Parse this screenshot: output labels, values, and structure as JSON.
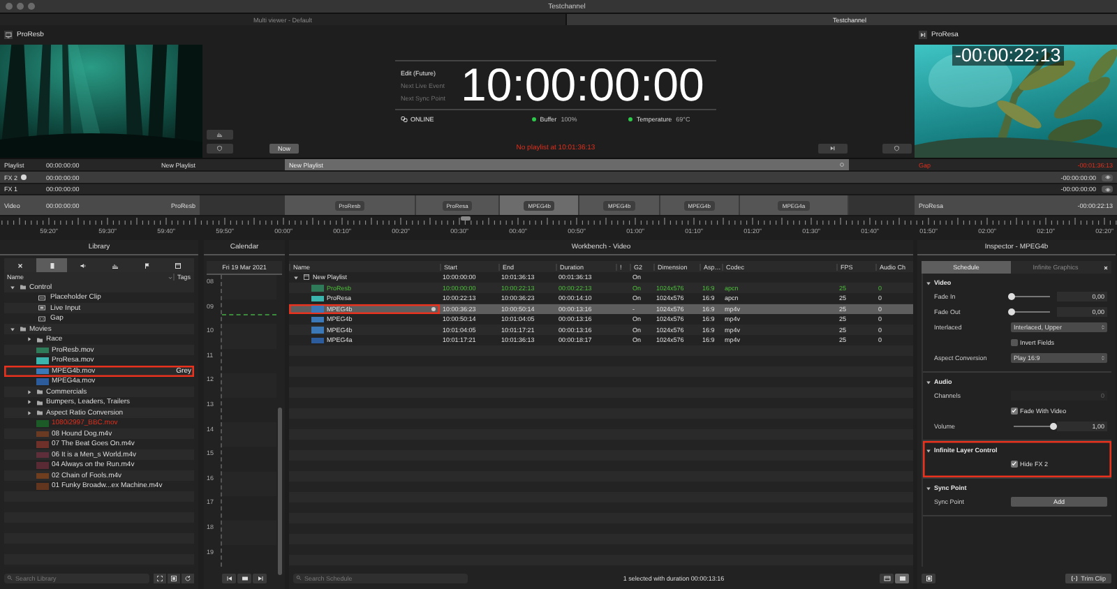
{
  "window": {
    "title": "Testchannel"
  },
  "tabs": [
    {
      "label": "Multi viewer - Default",
      "selected": false
    },
    {
      "label": "Testchannel",
      "selected": true
    }
  ],
  "program_preview": {
    "title": "ProResb",
    "kind": "picture"
  },
  "now_button": "Now",
  "clock": {
    "modes": [
      {
        "label": "Edit (Future)",
        "selected": true
      },
      {
        "label": "Next Live Event",
        "selected": false
      },
      {
        "label": "Next Sync Point",
        "selected": false
      }
    ],
    "time": "10:00:00:00",
    "connection": "ONLINE",
    "indicators": [
      {
        "label": "Buffer",
        "value": "100%",
        "color": "#2ec84a"
      },
      {
        "label": "Temperature",
        "value": "69°C",
        "color": "#2ec84a"
      }
    ],
    "message": "No playlist at 10:01:36:13"
  },
  "next_preview": {
    "title": "ProResa",
    "countdown": "-00:00:22:13",
    "kind": "picture"
  },
  "tracks": [
    {
      "name": "Playlist",
      "time": "00:00:00:00",
      "clip": "New Playlist",
      "marker": false
    },
    {
      "name": "FX 2",
      "time": "00:00:00:00",
      "marker": true
    },
    {
      "name": "FX 1",
      "time": "00:00:00:00",
      "marker": false
    },
    {
      "name": "Video",
      "time": "00:00:00:00",
      "clip": "ProResb",
      "marker": false
    }
  ],
  "timeline": {
    "playlist": "New Playlist",
    "blocks": [
      {
        "label": "ProResb",
        "selected": false
      },
      {
        "label": "ProResa",
        "selected": false
      },
      {
        "label": "MPEG4b",
        "selected": true
      },
      {
        "label": "MPEG4b",
        "selected": false
      },
      {
        "label": "MPEG4b",
        "selected": false
      },
      {
        "label": "MPEG4a",
        "selected": false
      }
    ]
  },
  "next_tracks": [
    {
      "kind": "playlist",
      "clip": "Gap",
      "time": "-00:01:36:13",
      "alert": true
    },
    {
      "kind": "layer",
      "time": "-00:00:00:00",
      "alert": false
    },
    {
      "kind": "layer",
      "time": "-00:00:00:00",
      "alert": false
    },
    {
      "kind": "video",
      "clip": "ProResa",
      "time": "-00:00:22:13",
      "alert": false
    }
  ],
  "ruler": {
    "labels": [
      "59:20\"",
      "59:30\"",
      "59:40\"",
      "59:50\"",
      "00:00\"",
      "00:10\"",
      "00:20\"",
      "00:30\"",
      "00:40\"",
      "00:50\"",
      "01:00\"",
      "01:10\"",
      "01:20\"",
      "01:30\"",
      "01:40\"",
      "01:50\"",
      "02:00\"",
      "02:10\"",
      "02:20\""
    ]
  },
  "library": {
    "title": "Library",
    "tools": [
      {
        "kind": "close",
        "selected": false
      },
      {
        "kind": "list",
        "selected": true
      },
      {
        "kind": "speaker",
        "selected": false
      },
      {
        "kind": "chart",
        "selected": false
      },
      {
        "kind": "flag",
        "selected": false
      },
      {
        "kind": "window",
        "selected": false
      }
    ],
    "columns": [
      "Name",
      "Tags"
    ],
    "items": [
      {
        "kind": "folder",
        "name": "Control",
        "expanded": true,
        "children": [
          {
            "kind": "placeholder",
            "name": "Placeholder Clip"
          },
          {
            "kind": "live",
            "name": "Live Input"
          },
          {
            "kind": "gap",
            "name": "Gap"
          }
        ]
      },
      {
        "kind": "folder",
        "name": "Movies",
        "expanded": true,
        "children": [
          {
            "kind": "folder",
            "name": "Race",
            "expanded": false
          },
          {
            "kind": "clip",
            "name": "ProResb.mov",
            "color": "#2f7a58"
          },
          {
            "kind": "clip",
            "name": "ProResa.mov",
            "color": "#3cb4ae"
          },
          {
            "kind": "clip",
            "name": "MPEG4b.mov",
            "color": "#3a78b8",
            "tag": "Grey",
            "annotated": true
          },
          {
            "kind": "clip",
            "name": "MPEG4a.mov",
            "color": "#2d5c9c"
          },
          {
            "kind": "folder",
            "name": "Commercials",
            "expanded": false
          },
          {
            "kind": "folder",
            "name": "Bumpers, Leaders, Trailers",
            "expanded": false
          },
          {
            "kind": "folder",
            "name": "Aspect Ratio Conversion",
            "expanded": false
          },
          {
            "kind": "clip",
            "name": "1080i2997_BBC.mov",
            "color": "#1c5a28",
            "missing": true
          },
          {
            "kind": "clip",
            "name": "08 Hound Dog.m4v",
            "color": "#6b3a22"
          },
          {
            "kind": "clip",
            "name": "07 The Beat Goes On.m4v",
            "color": "#70302a"
          },
          {
            "kind": "clip",
            "name": "06 It is a Men_s World.m4v",
            "color": "#5e2e3a"
          },
          {
            "kind": "clip",
            "name": "04 Always on the Run.m4v",
            "color": "#5a2a34"
          },
          {
            "kind": "clip",
            "name": "02 Chain of Fools.m4v",
            "color": "#6e3e1e"
          },
          {
            "kind": "clip",
            "name": "01 Funky Broadw...ex Machine.m4v",
            "color": "#62361e"
          }
        ]
      }
    ],
    "search_placeholder": "Search Library"
  },
  "calendar": {
    "title": "Calendar",
    "date": "Fri 19 Mar 2021",
    "hours": [
      "08",
      "09",
      "10",
      "11",
      "12",
      "13",
      "14",
      "15",
      "16",
      "17",
      "18",
      "19"
    ]
  },
  "workbench": {
    "title": "Workbench - Video",
    "columns": [
      "Name",
      "Start",
      "End",
      "Duration",
      "!",
      "G2",
      "Dimension",
      "Asp…",
      "Codec",
      "FPS",
      "Audio Ch"
    ],
    "rows": [
      {
        "kind": "playlist",
        "name": "New Playlist",
        "expanded": true,
        "selected": false,
        "playing": false,
        "start": "10:00:00:00",
        "end": "10:01:36:13",
        "duration": "00:01:36:13",
        "g2": "On",
        "children": [
          {
            "kind": "clip",
            "name": "ProResb",
            "color": "#2f7a58",
            "selected": false,
            "playing": true,
            "start": "10:00:00:00",
            "end": "10:00:22:13",
            "duration": "00:00:22:13",
            "g2": "On",
            "dimension": "1024x576",
            "aspect": "16:9",
            "codec": "apcn",
            "fps": "25",
            "audio": "0"
          },
          {
            "kind": "clip",
            "name": "ProResa",
            "color": "#3cb4ae",
            "selected": false,
            "playing": false,
            "start": "10:00:22:13",
            "end": "10:00:36:23",
            "duration": "00:00:14:10",
            "g2": "On",
            "dimension": "1024x576",
            "aspect": "16:9",
            "codec": "apcn",
            "fps": "25",
            "audio": "0"
          },
          {
            "kind": "clip",
            "name": "MPEG4b",
            "color": "#3a78b8",
            "selected": true,
            "playing": false,
            "annotated": true,
            "start": "10:00:36:23",
            "end": "10:00:50:14",
            "duration": "00:00:13:16",
            "g2": "-",
            "dimension": "1024x576",
            "aspect": "16:9",
            "codec": "mp4v",
            "fps": "25",
            "audio": "0"
          },
          {
            "kind": "clip",
            "name": "MPEG4b",
            "color": "#3a78b8",
            "selected": false,
            "playing": false,
            "start": "10:00:50:14",
            "end": "10:01:04:05",
            "duration": "00:00:13:16",
            "g2": "On",
            "dimension": "1024x576",
            "aspect": "16:9",
            "codec": "mp4v",
            "fps": "25",
            "audio": "0"
          },
          {
            "kind": "clip",
            "name": "MPEG4b",
            "color": "#3a78b8",
            "selected": false,
            "playing": false,
            "start": "10:01:04:05",
            "end": "10:01:17:21",
            "duration": "00:00:13:16",
            "g2": "On",
            "dimension": "1024x576",
            "aspect": "16:9",
            "codec": "mp4v",
            "fps": "25",
            "audio": "0"
          },
          {
            "kind": "clip",
            "name": "MPEG4a",
            "color": "#2d5c9c",
            "selected": false,
            "playing": false,
            "start": "10:01:17:21",
            "end": "10:01:36:13",
            "duration": "00:00:18:17",
            "g2": "On",
            "dimension": "1024x576",
            "aspect": "16:9",
            "codec": "mp4v",
            "fps": "25",
            "audio": "0"
          }
        ]
      }
    ],
    "search_placeholder": "Search Schedule",
    "status": "1 selected with duration 00:00:13:16"
  },
  "inspector": {
    "title": "Inspector - MPEG4b",
    "tabs": [
      {
        "label": "Schedule",
        "selected": true
      },
      {
        "label": "Infinite Graphics",
        "selected": false
      }
    ],
    "sections": [
      {
        "title": "Video",
        "expanded": true,
        "fields": [
          {
            "kind": "slider",
            "label": "Fade In",
            "level": 0,
            "value": "0,00"
          },
          {
            "kind": "slider",
            "label": "Fade Out",
            "level": 0,
            "value": "0,00"
          },
          {
            "kind": "select",
            "label": "Interlaced",
            "value": "Interlaced, Upper"
          },
          {
            "kind": "checkbox",
            "label": "Invert Fields",
            "checked": false
          },
          {
            "kind": "select",
            "label": "Aspect Conversion",
            "value": "Play 16:9"
          }
        ]
      },
      {
        "title": "Audio",
        "expanded": true,
        "fields": [
          {
            "kind": "number",
            "label": "Channels",
            "value": "0",
            "disabled": true
          },
          {
            "kind": "checkbox",
            "label": "Fade With Video",
            "checked": true
          },
          {
            "kind": "slider",
            "label": "Volume",
            "level": 1,
            "value": "1,00"
          }
        ]
      },
      {
        "title": "Infinite Layer Control",
        "expanded": true,
        "annotated": true,
        "fields": [
          {
            "kind": "checkbox",
            "label": "Hide FX 2",
            "checked": true
          }
        ]
      },
      {
        "title": "Sync Point",
        "expanded": true,
        "fields": [
          {
            "kind": "button",
            "label": "Sync Point",
            "value": "Add"
          }
        ]
      }
    ],
    "trim_button": "Trim Clip"
  }
}
